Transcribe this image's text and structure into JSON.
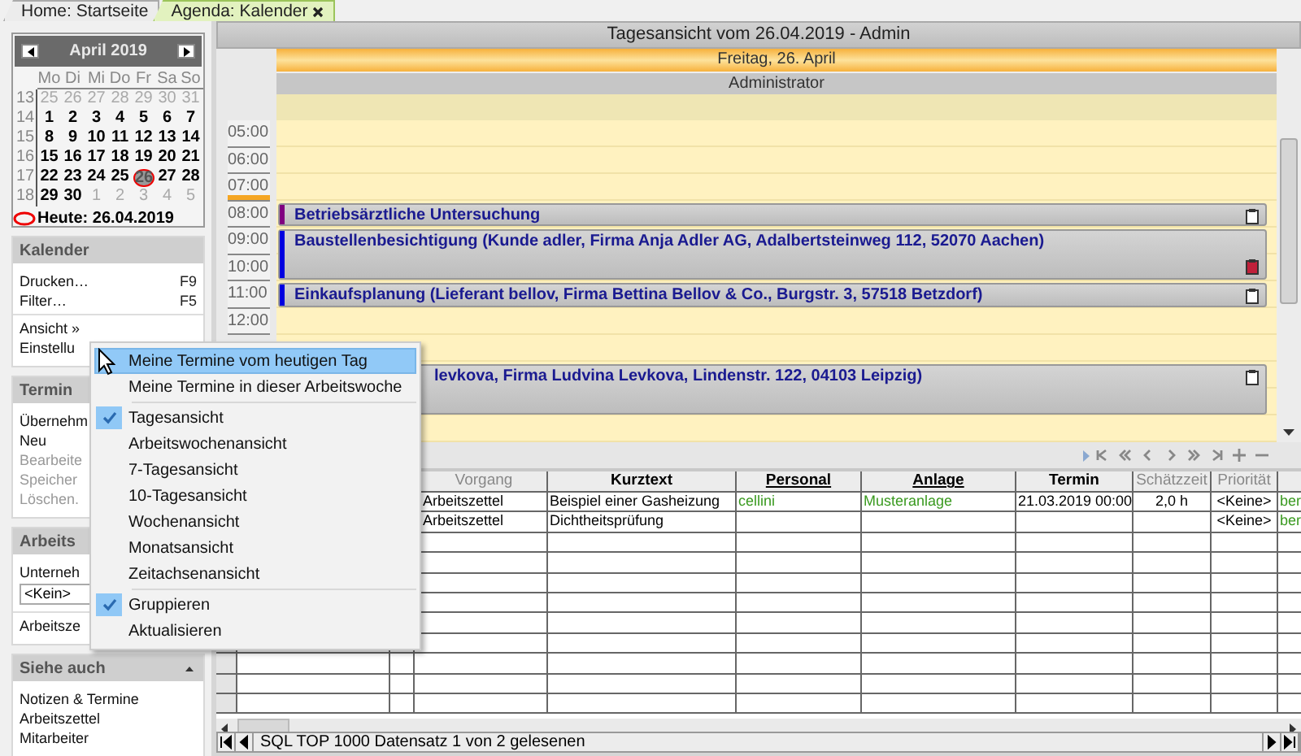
{
  "tabs": [
    {
      "label": "Home: Startseite",
      "selected": false
    },
    {
      "label": "Agenda: Kalender",
      "selected": true
    }
  ],
  "mini_calendar": {
    "month": "April 2019",
    "weekdays": [
      "Mo",
      "Di",
      "Mi",
      "Do",
      "Fr",
      "Sa",
      "So"
    ],
    "weeks": [
      {
        "number": "13",
        "days": [
          {
            "day": "25",
            "in_month": false,
            "today": false
          },
          {
            "day": "26",
            "in_month": false,
            "today": false
          },
          {
            "day": "27",
            "in_month": false,
            "today": false
          },
          {
            "day": "28",
            "in_month": false,
            "today": false
          },
          {
            "day": "29",
            "in_month": false,
            "today": false
          },
          {
            "day": "30",
            "in_month": false,
            "today": false
          },
          {
            "day": "31",
            "in_month": false,
            "today": false
          }
        ]
      },
      {
        "number": "14",
        "days": [
          {
            "day": "1",
            "in_month": true,
            "today": false
          },
          {
            "day": "2",
            "in_month": true,
            "today": false
          },
          {
            "day": "3",
            "in_month": true,
            "today": false
          },
          {
            "day": "4",
            "in_month": true,
            "today": false
          },
          {
            "day": "5",
            "in_month": true,
            "today": false
          },
          {
            "day": "6",
            "in_month": true,
            "today": false
          },
          {
            "day": "7",
            "in_month": true,
            "today": false
          }
        ]
      },
      {
        "number": "15",
        "days": [
          {
            "day": "8",
            "in_month": true,
            "today": false
          },
          {
            "day": "9",
            "in_month": true,
            "today": false
          },
          {
            "day": "10",
            "in_month": true,
            "today": false
          },
          {
            "day": "11",
            "in_month": true,
            "today": false
          },
          {
            "day": "12",
            "in_month": true,
            "today": false
          },
          {
            "day": "13",
            "in_month": true,
            "today": false
          },
          {
            "day": "14",
            "in_month": true,
            "today": false
          }
        ]
      },
      {
        "number": "16",
        "days": [
          {
            "day": "15",
            "in_month": true,
            "today": false
          },
          {
            "day": "16",
            "in_month": true,
            "today": false
          },
          {
            "day": "17",
            "in_month": true,
            "today": false
          },
          {
            "day": "18",
            "in_month": true,
            "today": false
          },
          {
            "day": "19",
            "in_month": true,
            "today": false
          },
          {
            "day": "20",
            "in_month": true,
            "today": false
          },
          {
            "day": "21",
            "in_month": true,
            "today": false
          }
        ]
      },
      {
        "number": "17",
        "days": [
          {
            "day": "22",
            "in_month": true,
            "today": false
          },
          {
            "day": "23",
            "in_month": true,
            "today": false
          },
          {
            "day": "24",
            "in_month": true,
            "today": false
          },
          {
            "day": "25",
            "in_month": true,
            "today": false
          },
          {
            "day": "26",
            "in_month": true,
            "today": true
          },
          {
            "day": "27",
            "in_month": true,
            "today": false
          },
          {
            "day": "28",
            "in_month": true,
            "today": false
          }
        ]
      },
      {
        "number": "18",
        "days": [
          {
            "day": "29",
            "in_month": true,
            "today": false
          },
          {
            "day": "30",
            "in_month": true,
            "today": false
          },
          {
            "day": "1",
            "in_month": false,
            "today": false
          },
          {
            "day": "2",
            "in_month": false,
            "today": false
          },
          {
            "day": "3",
            "in_month": false,
            "today": false
          },
          {
            "day": "4",
            "in_month": false,
            "today": false
          },
          {
            "day": "5",
            "in_month": false,
            "today": false
          }
        ]
      }
    ],
    "today_label": "Heute: 26.04.2019"
  },
  "sidebar_sections": [
    {
      "title": "Kalender",
      "groups": [
        [
          {
            "kind": "item",
            "label": "Drucken…",
            "shortcut": "F9",
            "disabled": false
          },
          {
            "kind": "item",
            "label": "Filter…",
            "shortcut": "F5",
            "disabled": false
          }
        ],
        [
          {
            "kind": "item",
            "label": "Ansicht »",
            "disabled": false
          },
          {
            "kind": "item",
            "label": "Einstellu",
            "disabled": false
          }
        ]
      ]
    },
    {
      "title": "Termin",
      "groups": [
        [
          {
            "kind": "item",
            "label": "Übernehm",
            "disabled": false
          },
          {
            "kind": "item",
            "label": "Neu",
            "disabled": false
          },
          {
            "kind": "item",
            "label": "Bearbeite",
            "disabled": true
          },
          {
            "kind": "item",
            "label": "Speicher",
            "disabled": true
          },
          {
            "kind": "item",
            "label": "Löschen.",
            "disabled": true
          }
        ]
      ]
    },
    {
      "title": "Arbeits",
      "groups": [
        [
          {
            "kind": "item",
            "label": "Unterneh",
            "disabled": false
          },
          {
            "kind": "field",
            "value": "<Kein>"
          }
        ],
        [
          {
            "kind": "item",
            "label": "Arbeitsze",
            "disabled": false
          }
        ]
      ]
    },
    {
      "title": "Siehe auch",
      "groups": [
        [
          {
            "kind": "item",
            "label": "Notizen & Termine",
            "disabled": false
          },
          {
            "kind": "item",
            "label": "Arbeitszettel",
            "disabled": false
          },
          {
            "kind": "item",
            "label": "Mitarbeiter",
            "disabled": false
          }
        ]
      ]
    }
  ],
  "day_view": {
    "title": "Tagesansicht vom 26.04.2019 - Admin",
    "day_header": "Freitag, 26. April",
    "resource": "Administrator",
    "hours": [
      "05:00",
      "06:00",
      "07:00",
      "08:00",
      "09:00",
      "10:00",
      "11:00",
      "12:00"
    ],
    "appointments": [
      {
        "title": "Betriebsärztliche Untersuchung",
        "color": "#800080"
      },
      {
        "title": "Baustellenbesichtigung (Kunde adler, Firma Anja Adler AG, Adalbertsteinweg 112, 52070 Aachen)",
        "color": "#0000e0"
      },
      {
        "title": "Einkaufsplanung (Lieferant bellov, Firma Bettina Bellov & Co., Burgstr. 3, 57518 Betzdorf)",
        "color": "#0000e0"
      },
      {
        "title": "levkova, Firma Ludvina Levkova, Lindenstr. 122, 04103 Leipzig)"
      }
    ]
  },
  "grid": {
    "columns": [
      {
        "label": "Vorgang"
      },
      {
        "label": "Kurztext"
      },
      {
        "label": "Personal"
      },
      {
        "label": "Anlage"
      },
      {
        "label": "Termin"
      },
      {
        "label": "Schätzzeit"
      },
      {
        "label": "Priorität"
      },
      {}
    ],
    "rows": [
      [
        "Arbeitszettel",
        "Beispiel einer Gasheizung",
        "cellini",
        "Musteranlage",
        "21.03.2019 00:00",
        "2,0 h",
        "<Keine>",
        "ber"
      ],
      [
        "Arbeitszettel",
        "Dichtheitsprüfung",
        null,
        null,
        null,
        null,
        "<Keine>",
        "ber"
      ]
    ]
  },
  "status_bar": "SQL TOP 1000 Datensatz 1 von 2 gelesenen",
  "context_menu": {
    "groups": [
      [
        {
          "label": "Meine Termine vom heutigen Tag",
          "checked": false,
          "selected": true
        },
        {
          "label": "Meine Termine in dieser Arbeitswoche",
          "checked": false,
          "selected": false
        }
      ],
      [
        {
          "label": "Tagesansicht",
          "checked": true,
          "selected": false
        },
        {
          "label": "Arbeitswochenansicht",
          "checked": false,
          "selected": false
        },
        {
          "label": "7-Tagesansicht",
          "checked": false,
          "selected": false
        },
        {
          "label": "10-Tagesansicht",
          "checked": false,
          "selected": false
        },
        {
          "label": "Wochenansicht",
          "checked": false,
          "selected": false
        },
        {
          "label": "Monatsansicht",
          "checked": false,
          "selected": false
        },
        {
          "label": "Zeitachsenansicht",
          "checked": false,
          "selected": false
        }
      ],
      [
        {
          "label": "Gruppieren",
          "checked": true,
          "selected": false
        },
        {
          "label": "Aktualisieren",
          "checked": false,
          "selected": false
        }
      ]
    ]
  }
}
